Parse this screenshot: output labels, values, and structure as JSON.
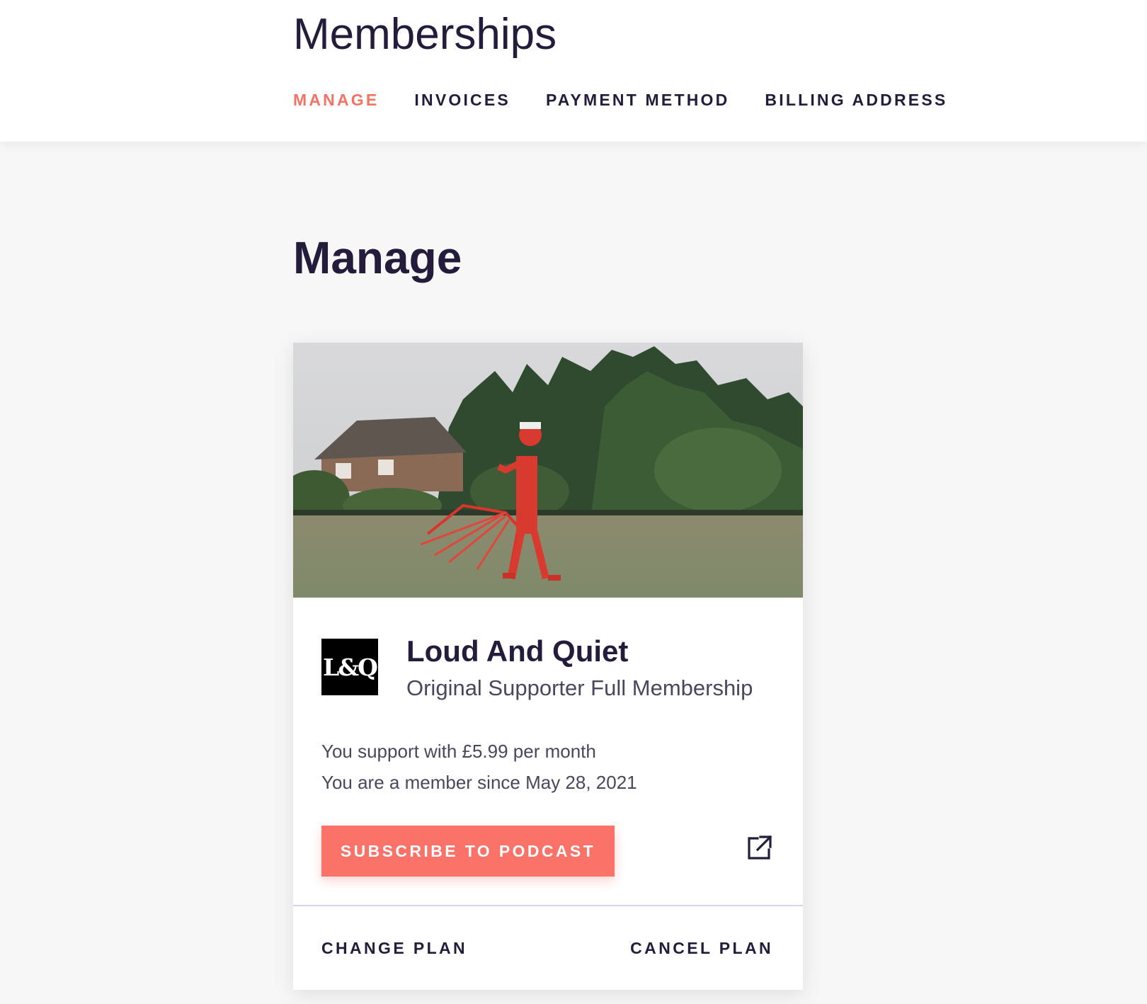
{
  "header": {
    "title": "Memberships",
    "tabs": [
      {
        "label": "MANAGE",
        "active": true
      },
      {
        "label": "INVOICES",
        "active": false
      },
      {
        "label": "PAYMENT METHOD",
        "active": false
      },
      {
        "label": "BILLING ADDRESS",
        "active": false
      }
    ]
  },
  "main": {
    "section_title": "Manage",
    "membership": {
      "logo_text": "L&Q",
      "name": "Loud And Quiet",
      "plan": "Original Supporter Full Membership",
      "support_line": "You support with £5.99 per month",
      "member_since_line": "You are a member since May 28, 2021",
      "subscribe_label": "SUBSCRIBE TO PODCAST",
      "external_icon": "external-link-icon",
      "change_plan_label": "CHANGE PLAN",
      "cancel_plan_label": "CANCEL PLAN"
    }
  },
  "colors": {
    "accent": "#f47366",
    "button": "#fa7268",
    "text": "#231c3a",
    "muted_text": "#4b465c",
    "background": "#f7f7f7",
    "divider": "#d6d3ee"
  }
}
